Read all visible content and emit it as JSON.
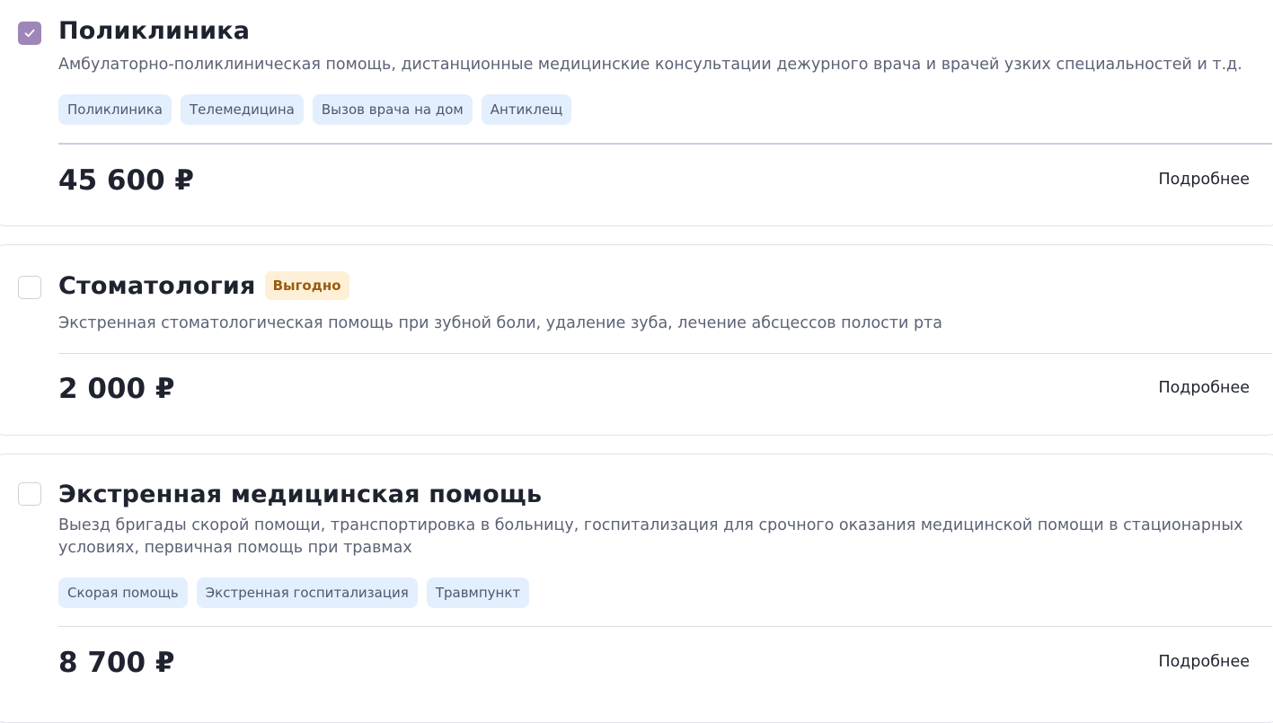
{
  "services": [
    {
      "checked": true,
      "title": "Поликлиника",
      "badge": "",
      "description": "Амбулаторно-поликлиническая помощь, дистанционные медицинские консультации дежурного врача и врачей узких специальностей и т.д.",
      "tags": [
        "Поликлиника",
        "Телемедицина",
        "Вызов врача на дом",
        "Антиклещ"
      ],
      "price": "45 600 ₽",
      "more_label": "Подробнее"
    },
    {
      "checked": false,
      "title": "Стоматология",
      "badge": "Выгодно",
      "description": "Экстренная стоматологическая помощь при зубной боли, удаление зуба, лечение абсцессов полости рта",
      "tags": [],
      "price": "2 000 ₽",
      "more_label": "Подробнее"
    },
    {
      "checked": false,
      "title": "Экстренная медицинская помощь",
      "badge": "",
      "description": "Выезд бригады скорой помощи, транспортировка в больницу, госпитализация для срочного оказания медицинской помощи в стационарных условиях, первичная помощь при травмах",
      "tags": [
        "Скорая помощь",
        "Экстренная госпитализация",
        "Травмпункт"
      ],
      "price": "8 700 ₽",
      "more_label": "Подробнее"
    }
  ],
  "colors": {
    "checkbox_checked": "#9f86b8",
    "tag_bg": "#e3effc",
    "badge_bg": "#fdf0d6",
    "badge_text": "#9a5a12"
  },
  "icons": {
    "checkbox_checked": "checkmark-icon"
  }
}
